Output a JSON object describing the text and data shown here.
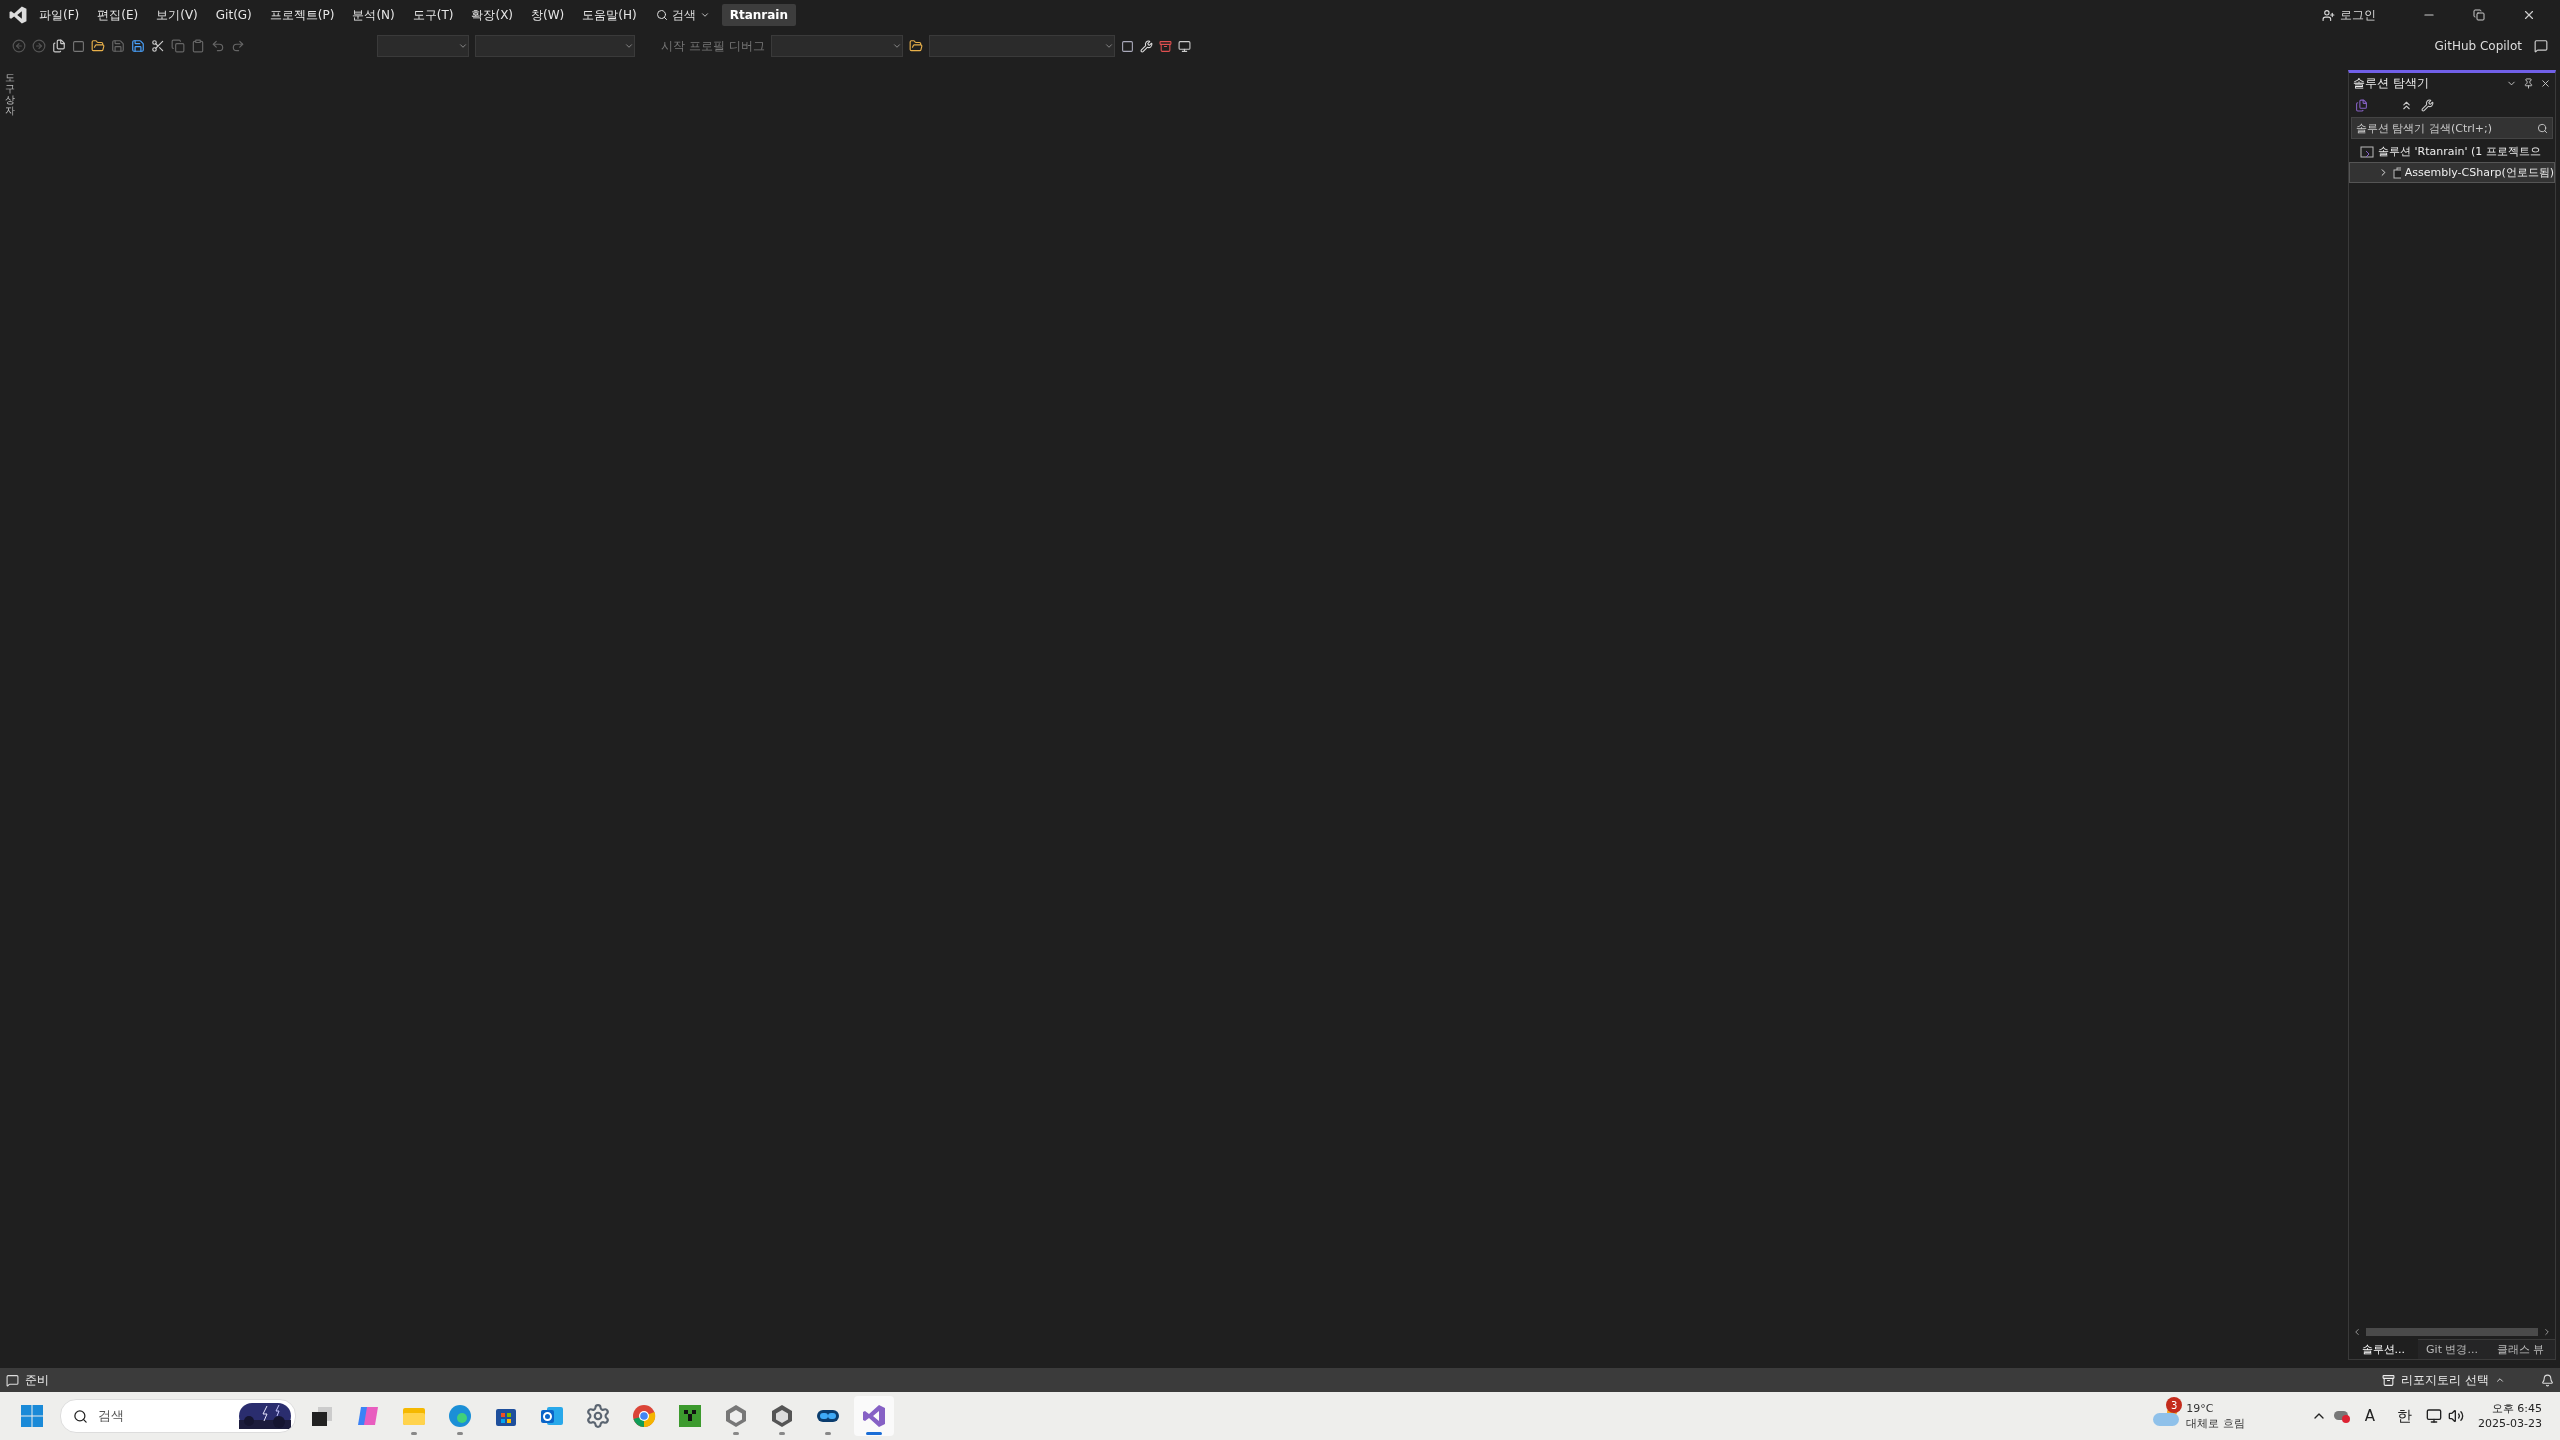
{
  "menu": [
    "파일(F)",
    "편집(E)",
    "보기(V)",
    "Git(G)",
    "프로젝트(P)",
    "분석(N)",
    "도구(T)",
    "확장(X)",
    "창(W)",
    "도움말(H)"
  ],
  "search": {
    "label": "검색"
  },
  "project_name": "Rtanrain",
  "account": {
    "login": "로그인"
  },
  "copilot": "GitHub Copilot",
  "toolbar": {
    "debug_profile": "시작 프로필 디버그"
  },
  "toolbox": "도구 상자",
  "solution_explorer": {
    "title": "솔루션 탐색기",
    "search": {
      "placeholder": "솔루션 탐색기 검색(Ctrl+;)"
    },
    "tree": [
      {
        "label": "솔루션 'Rtanrain' (1 프로젝트으",
        "selected": false,
        "children": [
          {
            "label": "Assembly-CSharp(언로드됨)",
            "selected": true,
            "expanded": false
          }
        ]
      }
    ],
    "tabs": [
      {
        "label": "솔루션...",
        "selected": true
      },
      {
        "label": "Git 변경...",
        "selected": false
      },
      {
        "label": "클래스 뷰",
        "selected": false
      }
    ]
  },
  "status_bar": {
    "message": "준비",
    "repository": "리포지토리 선택"
  },
  "taskbar": {
    "search": {
      "placeholder": "검색"
    },
    "apps": [
      {
        "kind": "taskview",
        "running": false,
        "selected": false
      },
      {
        "kind": "copilot",
        "running": false,
        "selected": false
      },
      {
        "kind": "explorer",
        "running": true,
        "selected": false
      },
      {
        "kind": "edge",
        "running": true,
        "selected": false
      },
      {
        "kind": "store",
        "running": false,
        "selected": false
      },
      {
        "kind": "outlook",
        "running": false,
        "selected": false
      },
      {
        "kind": "settings",
        "running": false,
        "selected": false
      },
      {
        "kind": "chrome",
        "running": false,
        "selected": false
      },
      {
        "kind": "minecraft",
        "running": false,
        "selected": false
      },
      {
        "kind": "unity",
        "running": true,
        "selected": false
      },
      {
        "kind": "unityhub",
        "running": true,
        "selected": false
      },
      {
        "kind": "cloud",
        "running": true,
        "selected": false
      },
      {
        "kind": "visualstudio",
        "running": true,
        "selected": true
      }
    ],
    "weather": {
      "badge": "3",
      "temperature": "19°C",
      "condition": "대체로 흐림"
    },
    "tray": {
      "font": "A",
      "ime": "한"
    },
    "clock": {
      "time": "오후 6:45",
      "date": "2025-03-23"
    }
  }
}
